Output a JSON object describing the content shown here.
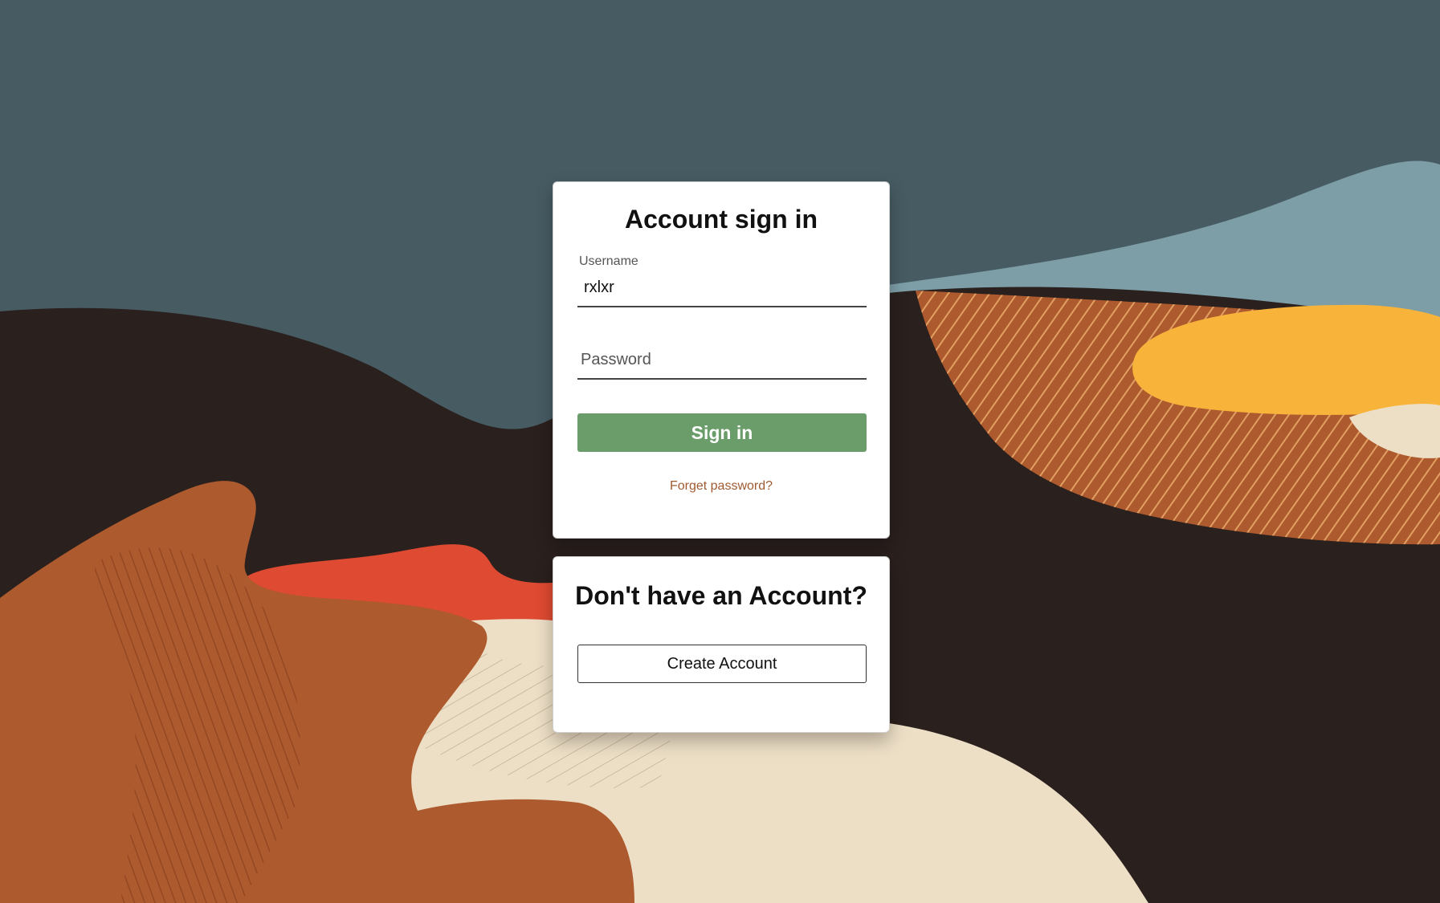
{
  "signin": {
    "title": "Account sign in",
    "username_label": "Username",
    "username_value": "rxlxr",
    "password_placeholder": "Password",
    "signin_button": "Sign in",
    "forgot_link": "Forget password?"
  },
  "create": {
    "title": "Don't have an Account?",
    "create_button": "Create Account"
  },
  "colors": {
    "sky": "#475b63",
    "light_sky": "#7d9ea7",
    "dark_ground": "#2a201e",
    "rust": "#ad5a2e",
    "red": "#df4a32",
    "yellow": "#f8b33a",
    "cream": "#eddfc6",
    "button_green": "#6a9d69",
    "link_brown": "#a05a30"
  }
}
